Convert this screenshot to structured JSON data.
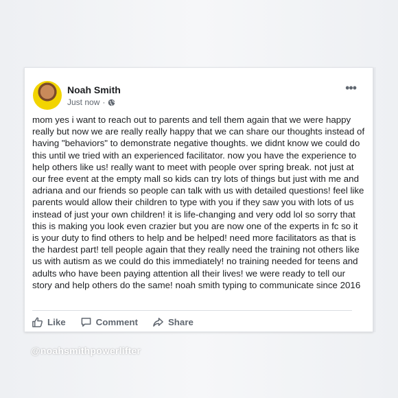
{
  "post": {
    "author": "Noah Smith",
    "timestamp": "Just now",
    "separator": "·",
    "privacy_icon": "globe-icon",
    "more_icon": "more-options-icon",
    "more_glyph": "•••",
    "body": "mom yes i want to reach out to parents and tell them again that we were happy really but now we are really really happy that we can share our thoughts instead of having \"behaviors\" to demonstrate negative thoughts. we didnt know we could do this until we tried with an experienced facilitator. now you have the experience to help others like us! really want to meet with people over spring break. not just at our free event at the empty mall so kids can try lots of things but just with me and adriana and our friends so people can talk with us with detailed questions! feel like parents would allow their children to type with you if they saw you with lots of us instead of just your own children! it is life-changing and very odd lol so sorry that this is making you look even crazier but you are now one of the experts in fc so it is your duty to find others to help and be helped! need more facilitators as that is the hardest part! tell people again that they really need the training not others like us with autism as we could do this immediately! no training needed for teens and adults who have been paying attention all their lives! we were ready to tell our story and help others do the same! noah smith typing to communicate since 2016"
  },
  "actions": {
    "like": "Like",
    "comment": "Comment",
    "share": "Share"
  },
  "watermark": "@noahsmithpowerlifter",
  "colors": {
    "text": "#1c1e21",
    "secondary": "#606770",
    "card": "#ffffff",
    "background": "#f4f5f7"
  }
}
